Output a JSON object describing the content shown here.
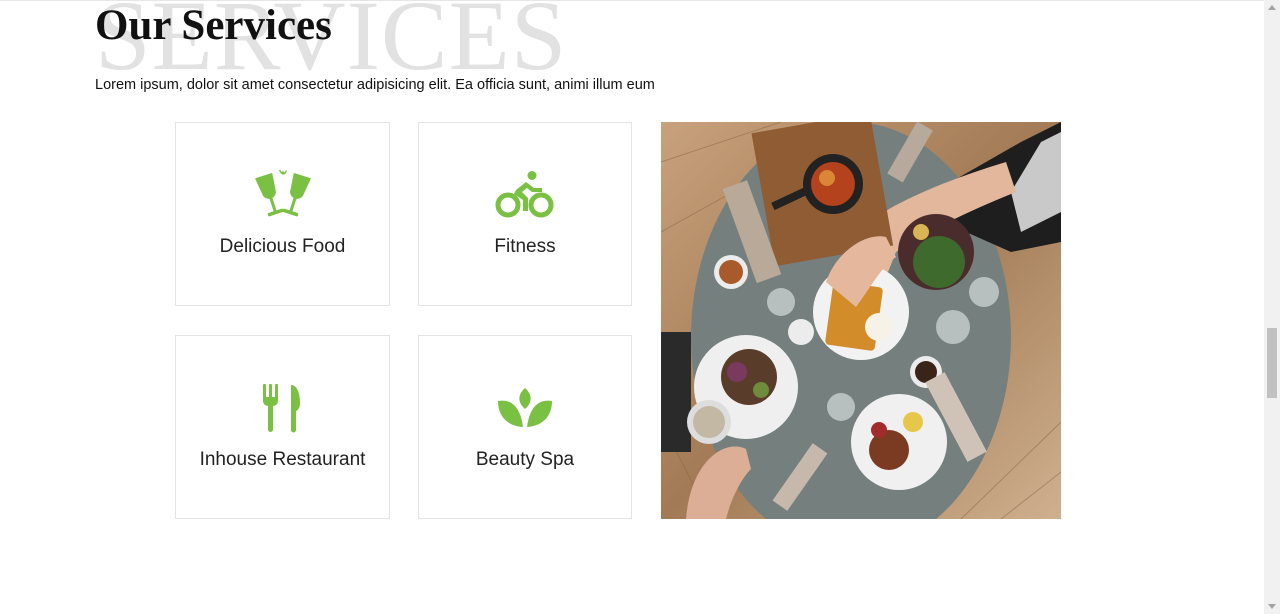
{
  "section": {
    "watermark": "SERVICES",
    "title": "Our Services",
    "description": "Lorem ipsum, dolor sit amet consectetur adipisicing elit. Ea officia sunt, animi illum eum"
  },
  "services": [
    {
      "label": "Delicious Food",
      "icon": "cheers-glasses-icon"
    },
    {
      "label": "Fitness",
      "icon": "bicycle-rider-icon"
    },
    {
      "label": "Inhouse Restaurant",
      "icon": "fork-knife-icon"
    },
    {
      "label": "Beauty Spa",
      "icon": "lotus-leaf-icon"
    }
  ],
  "image": {
    "subject": "food-table-photo"
  },
  "colors": {
    "accent": "#79c043",
    "border": "#e4e4e4",
    "text": "#222222",
    "watermark": "#e2e2e2"
  }
}
